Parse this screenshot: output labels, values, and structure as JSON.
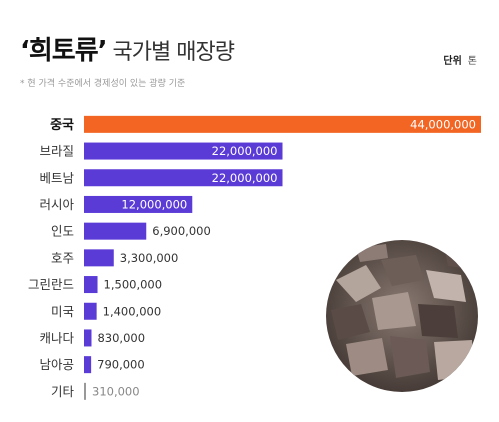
{
  "header": {
    "title_strong": "‘희토류’",
    "title_rest": "국가별 매장량",
    "unit_label": "단위",
    "unit_value": "톤",
    "note": "* 현 가격 수준에서 경제성이 있는 광량 기준"
  },
  "colors": {
    "highlight": "#f26522",
    "bar": "#5b3bd6",
    "bar_min": "#999999",
    "label_highlight": "#111111",
    "label": "#333333"
  },
  "image": {
    "name": "rare-earth-ore-photo"
  },
  "chart_data": {
    "type": "bar",
    "orientation": "horizontal",
    "title": "‘희토류’ 국가별 매장량",
    "unit": "톤",
    "categories": [
      "중국",
      "브라질",
      "베트남",
      "러시아",
      "인도",
      "호주",
      "그린란드",
      "미국",
      "캐나다",
      "남아공",
      "기타"
    ],
    "values": [
      44000000,
      22000000,
      22000000,
      12000000,
      6900000,
      3300000,
      1500000,
      1400000,
      830000,
      790000,
      310000
    ],
    "value_labels": [
      "44,000,000",
      "22,000,000",
      "22,000,000",
      "12,000,000",
      "6,900,000",
      "3,300,000",
      "1,500,000",
      "1,400,000",
      "830,000",
      "790,000",
      "310,000"
    ],
    "highlight_index": 0,
    "xlim": [
      0,
      44000000
    ],
    "grid": false,
    "legend": "none"
  }
}
